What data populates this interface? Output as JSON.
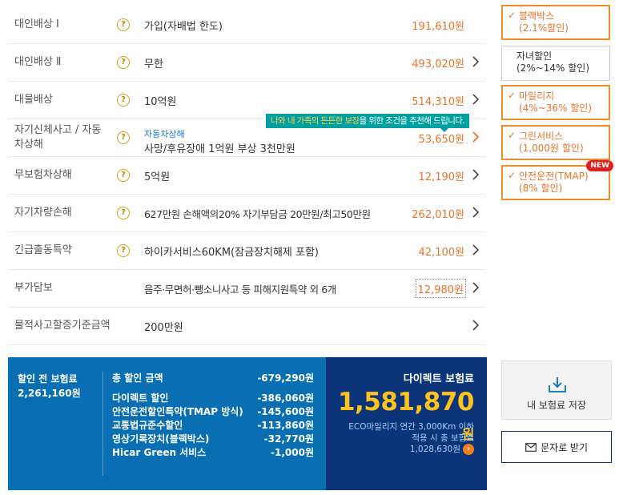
{
  "coverages": [
    {
      "label": "대인배상 Ⅰ",
      "help": "?",
      "desc": "가입(자배법 한도)",
      "price": "191,610원",
      "chevron": false
    },
    {
      "label": "대인배상 Ⅱ",
      "help": "?",
      "desc": "무한",
      "price": "493,020원",
      "chevron": true
    },
    {
      "label": "대물배상",
      "help": "?",
      "desc": "10억원",
      "price": "514,310원",
      "chevron": true
    },
    {
      "label": "자기신체사고 / 자동차상해",
      "help": "?",
      "sub": "자동차상해",
      "desc": "사망/후유장애 1억원 부상 3천만원",
      "price": "53,650원",
      "chevron": true
    },
    {
      "label": "무보험차상해",
      "help": "?",
      "desc": "5억원",
      "price": "12,190원",
      "chevron": true
    },
    {
      "label": "자기차량손해",
      "help": "?",
      "desc": "627만원 손해액의20% 자기부담금 20만원/최고50만원",
      "price": "262,010원",
      "chevron": true
    },
    {
      "label": "긴급출동특약",
      "help": "?",
      "desc": "하이카서비스60KM(잠금장치해제 포함)",
      "price": "42,100원",
      "chevron": true
    },
    {
      "label": "부가담보",
      "desc": "음주·무면허·뺑소니사고 등 피해지원특약 외 6개",
      "price": "12,980원",
      "chevron": true
    },
    {
      "label": "물적사고할증기준금액",
      "desc": "200만원",
      "price": "",
      "chevron": true
    }
  ],
  "tooltip": {
    "highlight": "나와 내 가족의 든든한 보장",
    "rest": "을 위한 조건을 추천해 드립니다."
  },
  "discounts": [
    {
      "name": "블랙박스",
      "rate": "(2.1%할인)",
      "active": true,
      "check": "✓"
    },
    {
      "name": "자녀할인",
      "rate": "(2%~14% 할인)",
      "active": false
    },
    {
      "name": "마일리지",
      "rate": "(4%~36% 할인)",
      "active": true,
      "check": "✓"
    },
    {
      "name": "그린서비스",
      "rate": "(1,000원 할인)",
      "active": true,
      "check": "✓"
    },
    {
      "name": "안전운전(TMAP)",
      "rate": "(8% 할인)",
      "active": true,
      "check": "✓",
      "badge": "NEW"
    }
  ],
  "summary": {
    "before_label": "할인 전 보험료",
    "before_value": "2,261,160원",
    "total_label": "총 할인 금액",
    "total_value": "-679,290원",
    "items": [
      {
        "label": "다이렉트 할인",
        "value": "-386,060원"
      },
      {
        "label": "안전운전할인특약(TMAP 방식)",
        "value": "-145,600원"
      },
      {
        "label": "교통법규준수할인",
        "value": "-113,860원"
      },
      {
        "label": "영상기록장치(블랙박스)",
        "value": "-32,770원"
      },
      {
        "label": "Hicar Green 서비스",
        "value": "-1,000원"
      }
    ]
  },
  "direct": {
    "title": "다이렉트 보험료",
    "amount": "1,581,870",
    "unit": "원",
    "eco_line1": "ECO마일리지 연간 3,000Km 이하",
    "eco_line2": "적용 시 총 보험료",
    "eco_value": "1,028,630원"
  },
  "buttons": {
    "save": "내 보험료 저장",
    "sms": "문자로 받기"
  },
  "colors": {
    "accent": "#f08c2b",
    "price": "#e8732a",
    "summary_bg": "#0a6fb2",
    "direct_bg": "#0b3578",
    "direct_amount": "#ffc21f"
  }
}
